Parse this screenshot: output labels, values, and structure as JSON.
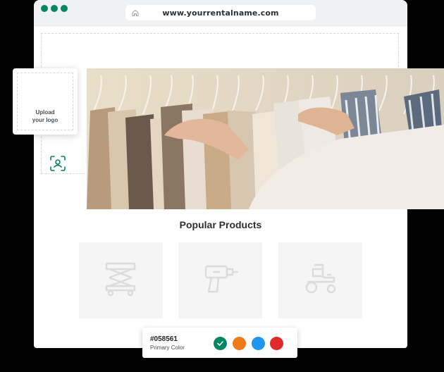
{
  "browser": {
    "url": "www.yourrentalname.com",
    "dot_color": "#058561"
  },
  "logo_upload": {
    "icon": "face-scan-icon",
    "line1": "Upload",
    "line2": "your logo"
  },
  "hero": {
    "description_icon": "hero-clothing-rack-photo"
  },
  "products": {
    "title": "Popular Products",
    "items": [
      {
        "icon": "scissor-lift-icon"
      },
      {
        "icon": "power-drill-icon"
      },
      {
        "icon": "lawn-tractor-icon"
      }
    ]
  },
  "color_picker": {
    "hex": "#058561",
    "label": "Primary Color",
    "swatches": [
      {
        "color": "#058561",
        "selected": true
      },
      {
        "color": "#f07a19",
        "selected": false
      },
      {
        "color": "#1e96f0",
        "selected": false
      },
      {
        "color": "#e22a2a",
        "selected": false
      }
    ]
  }
}
